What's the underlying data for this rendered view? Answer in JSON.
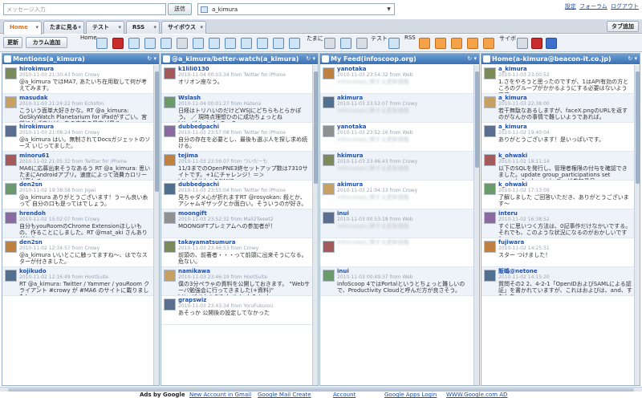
{
  "top": {
    "message_placeholder": "メッセージ入力",
    "send_label": "送信",
    "account": "a_kimura",
    "links": [
      "設定",
      "フォーラム",
      "ログアウト"
    ]
  },
  "tabs": [
    {
      "label": "Home",
      "active": true
    },
    {
      "label": "たまに見る"
    },
    {
      "label": "テスト"
    },
    {
      "label": "RSS"
    },
    {
      "label": "サイボウス"
    }
  ],
  "add_tab_label": "タブ追加",
  "toolbar": {
    "refresh_label": "更新",
    "add_column_label": "カラム追加",
    "groups": [
      "Home",
      "たまに",
      "テスト",
      "RSS",
      "サイボ"
    ]
  },
  "columns": [
    {
      "title": "Mentions(a_kimura)",
      "tweets": [
        {
          "user": "hirokimura",
          "meta": "2010-11-03 21:30:43 from Crowy",
          "text": "@a_kimura でほMA7, あたいち在用取して何が考えてみます。"
        },
        {
          "user": "masudak",
          "meta": "2010-11-03 21:24:22 from Echofon",
          "text": "こういう面単大好きかな。RT @a_kimura: GoSkyWatch Planetarium for iPadがすごい。宮前にかざすとどっちの方向の星座が見る。"
        },
        {
          "user": "hirokimura",
          "meta": "2010-11-03 21:08:24 from Crowy",
          "text": "@a_kimura はい。無制されてDocsガジェットのソース いじってました。"
        },
        {
          "user": "minoru61",
          "meta": "2010-11-02 21:05:32 from Twitter for iPhone",
          "text": "MA6に応募出来そうなあるう RT @a_kimura: 思い たまにAndroidアプリ。速度によって消費カロリーが変わる。"
        },
        {
          "user": "den2sn",
          "meta": "2010-11-02 19:38:58 from Jigwi",
          "text": "@a_kimura ありがとうございます！うーん良い糸って 自分の口も是ってはでしょう。"
        },
        {
          "user": "hrendoh",
          "meta": "2010-11-02 15:02:07 from Crowy",
          "text": "自分もyouRoomのChrome Extensionほしいもの、作ることにしました。RT @mat_aki さんありがとう。"
        },
        {
          "user": "den2sn",
          "meta": "2010-11-02 12:34:57 from Crowy",
          "text": "@a_kimura いいとこに触ってますね〜、はでなスターが付きました。"
        },
        {
          "user": "kojikudo",
          "meta": "2010-11-02 12:16:49 from HootSuite",
          "text": "RT @a_kimura: Twitter / Yammer / youRoom クライアント #crowy が #MA6 のサイトに載りました！"
        }
      ]
    },
    {
      "title": "@a_kimura/better-watch(a_kimura)",
      "tweets": [
        {
          "user": "k1lili0130",
          "meta": "2010-11-04 00:03:34 from Twitter for iPhone",
          "text": "オリオン座なう。"
        },
        {
          "user": "Wslash",
          "meta": "2010-11-04 00:01:27 from Hatena",
          "text": "日経はトリハいのだけどWSJにどちらもとらかぽう。 ／ 現時点理想ひのに成功ちょっとね http://htn.to/koGovC"
        },
        {
          "user": "dubbedpachi",
          "meta": "2010-11-03 23:57:08 from Twitter for iPhone",
          "text": "自分の存在を必要とし、最後も選ぶ人を探し求め続ける。"
        },
        {
          "user": "tejima",
          "meta": "2010-11-03 23:56:07 from ついだーも",
          "text": "11/3までのOpenPNE3終セットアップ数は7310サイトです。+1にチャレンジ！＝＞ http://bit.ly/aF4WK2"
        },
        {
          "user": "dubbedpachi",
          "meta": "2010-11-03 23:55:04 from Twitter for iPhone",
          "text": "見ちゃダメ心が折れますRT @rosyokan: 殺とか、アシャムギザッグとか面白い。そういうのが好き。"
        },
        {
          "user": "moongift",
          "meta": "2010-11-03 23:52:32 from Mail2Tweet2",
          "text": "MOONGIFTプレミアムへの参加者が！"
        },
        {
          "user": "takayamatsumura",
          "meta": "2010-11-03 23:46:53 from Crowy",
          "text": "前頭の、前著者・・・って前頭に出来そうになる。危ない。"
        },
        {
          "user": "namikawa",
          "meta": "2010-11-03 23:46:19 from HootSuite",
          "text": "僕の3分ペラゃの資料を公開しておきます。 \"Webサーバ勉強会に行ってきました(+資料)\" http://bit.ly/a3j8xb #study2study"
        },
        {
          "user": "grapswiz",
          "meta": "2010-11-03 23:43:34 from YoruFukurou",
          "text": "あそっか 公開後の設定してなかった"
        }
      ]
    },
    {
      "title": "My Feed(infoscoop.org)",
      "tweets": [
        {
          "user": "yanotaka",
          "meta": "2010-11-03 23:54:32 from Web",
          "text": "infoscoopに関する更新情報",
          "blur": true
        },
        {
          "user": "akimura",
          "meta": "2010-11-03 23:52:07 from Crowy",
          "text": "infoscoopに関する更新情報",
          "blur": true
        },
        {
          "user": "yanotaka",
          "meta": "2010-11-03 23:52:16 from Web",
          "text": "infoscoopに関する更新情報",
          "blur": true
        },
        {
          "user": "hkimura",
          "meta": "2010-11-03 23:46:43 from Crowy",
          "text": "infoscoopに関する更新情報",
          "blur": true
        },
        {
          "user": "akimura",
          "meta": "2010-11-03 21:04:13 from Crowy",
          "text": "infoscoopに関する更新情報",
          "blur": true
        },
        {
          "user": "inui",
          "meta": "2010-11-03 00:53:18 from Web",
          "text": "infoscoopに関する更新情報",
          "blur": true
        },
        {
          "user": "",
          "meta": "",
          "text": "infoscoopに関する更新情報",
          "blur": true
        },
        {
          "user": "inui",
          "meta": "2010-11-03 00:49:37 from Web",
          "text": "infoScoop 4ではPortalというとちょっと難しいので、Productivity Cloudと呼んだ方が良さそう。"
        }
      ]
    },
    {
      "title": "Home(a-kimura@beacon-it.co.jp)",
      "tweets": [
        {
          "user": "a_kimura",
          "meta": "2010-11-03 23:00:52",
          "text": "1.さをやろうと思ったのですが、1はAPI有効の方ところのグループがかかるようにする必要はないようです。"
        },
        {
          "user": "a_kimura",
          "meta": "2010-11-03 22:38:00",
          "text": "若干無駄なあるしますが、faceX.pngのURLを返すのがなんかの事情で難しいようであれば。"
        },
        {
          "user": "a_kimura",
          "meta": "2010-11-02 19:40:04",
          "text": "ありがとうございます！是いっぱいです。"
        },
        {
          "user": "k_ohwaki",
          "meta": "2010-11-02 18:11:14",
          "text": "以下のSQLを発行し、管理者権限の付与を確認できました。update group_participations set owned=1 where id=ユーザ参加番号"
        },
        {
          "user": "k_ohwaki",
          "meta": "2010-11-02 17:13:09",
          "text": "了解しました ご回答いただき、ありがとうございます〜"
        },
        {
          "user": "interu",
          "meta": "2010-11-02 16:38:52",
          "text": "すぐに思いつく方法は、0記事作だけなかいでする。それでも、このような状況になるのがおかしいですし。"
        },
        {
          "user": "fujiwara",
          "meta": "2010-11-02 14:25:51",
          "text": "スター つけました！"
        },
        {
          "user": "飯嶋@netone",
          "meta": "2010-11-02 14:15:20",
          "text": "質問その2 2、4-2-1「OpenIDおよびSAMLによる認証」を書かれていますが、これはおよびは、and、すなわち、or"
        }
      ]
    }
  ],
  "footer": {
    "ads": "Ads by Google",
    "links": [
      "New Account in Gmail",
      "Google Mail Create",
      "Account",
      "Google Apps Login",
      "WWW.Google.com AD"
    ]
  }
}
